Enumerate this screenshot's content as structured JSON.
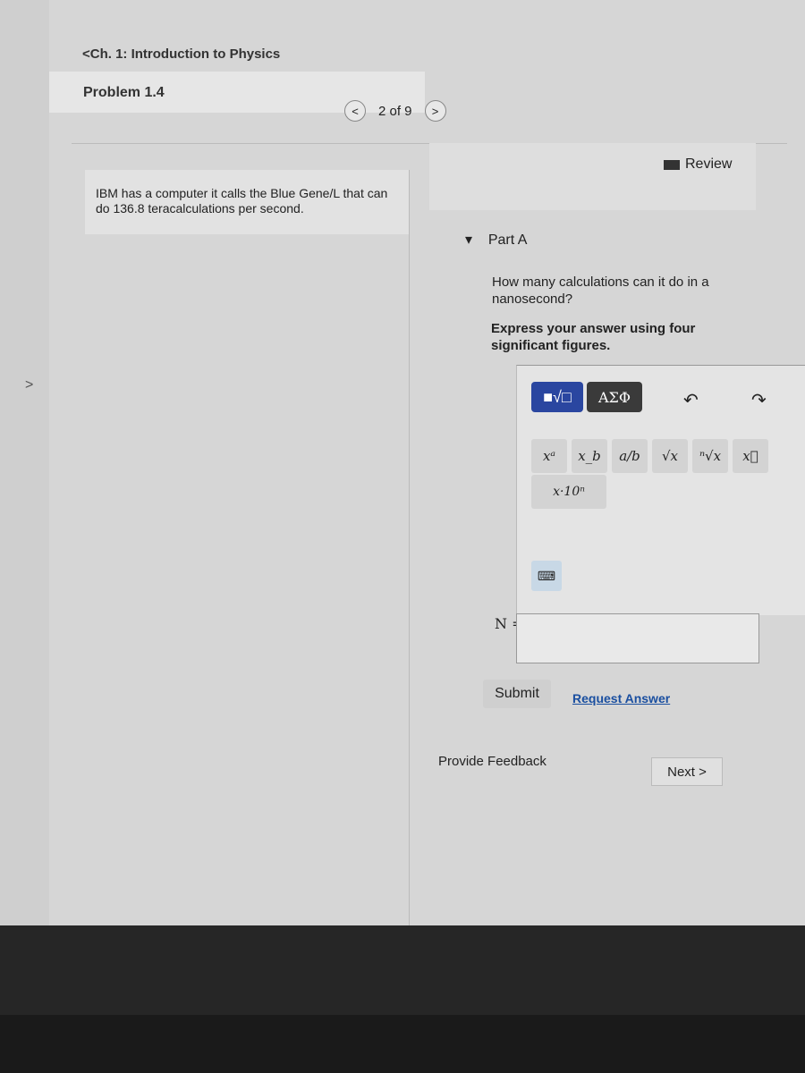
{
  "breadcrumb": "<Ch. 1: Introduction to Physics",
  "problem_title": "Problem 1.4",
  "pager": {
    "prev": "<",
    "position": "2 of 9",
    "next": ">"
  },
  "statement": "IBM has a computer it calls the Blue Gene/L that can do 136.8 teracalculations per second.",
  "review": "Review",
  "part": {
    "label": "Part A",
    "question": "How many calculations can it do in a nanosecond?",
    "instruction": "Express your answer using four significant figures."
  },
  "toolbar": {
    "templates": "■√□",
    "greek": "ΑΣΦ",
    "undo": "↶",
    "redo": "↷",
    "buttons": [
      "xᵃ",
      "x_b",
      "a/b",
      "√x",
      "ⁿ√x",
      "x⃗"
    ],
    "sci": "x·10ⁿ",
    "keyboard": "⌨"
  },
  "answer": {
    "label": "N =",
    "value": ""
  },
  "submit": "Submit",
  "request_answer": "Request Answer",
  "feedback": "Provide Feedback",
  "next": "Next >"
}
